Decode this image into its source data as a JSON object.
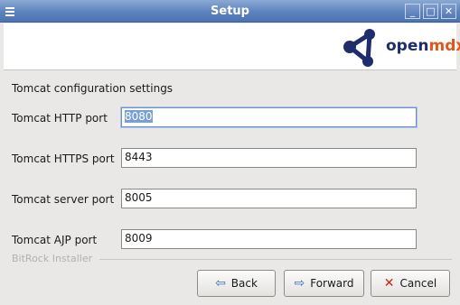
{
  "window": {
    "title": "Setup",
    "menu_icon": "window-menu-icon",
    "controls": {
      "minimize": "_",
      "maximize": "□",
      "close": "✕"
    }
  },
  "header": {
    "logo_text_open": "open",
    "logo_text_dx": "mdx",
    "logo_icon": "network-nodes-icon",
    "brand_colors": {
      "navy": "#1e2d6b",
      "orange": "#e0561b"
    }
  },
  "form": {
    "section_title": "Tomcat configuration settings",
    "fields": [
      {
        "label": "Tomcat HTTP port",
        "value": "8080",
        "focused": true
      },
      {
        "label": "Tomcat HTTPS port",
        "value": "8443"
      },
      {
        "label": "Tomcat server port",
        "value": "8005"
      },
      {
        "label": "Tomcat AJP port",
        "value": "8009"
      }
    ]
  },
  "footer": {
    "brand": "BitRock Installer",
    "buttons": {
      "back": {
        "label": "Back",
        "icon": "arrow-left-icon"
      },
      "forward": {
        "label": "Forward",
        "icon": "arrow-right-icon"
      },
      "cancel": {
        "label": "Cancel",
        "icon": "cancel-x-icon"
      }
    }
  }
}
